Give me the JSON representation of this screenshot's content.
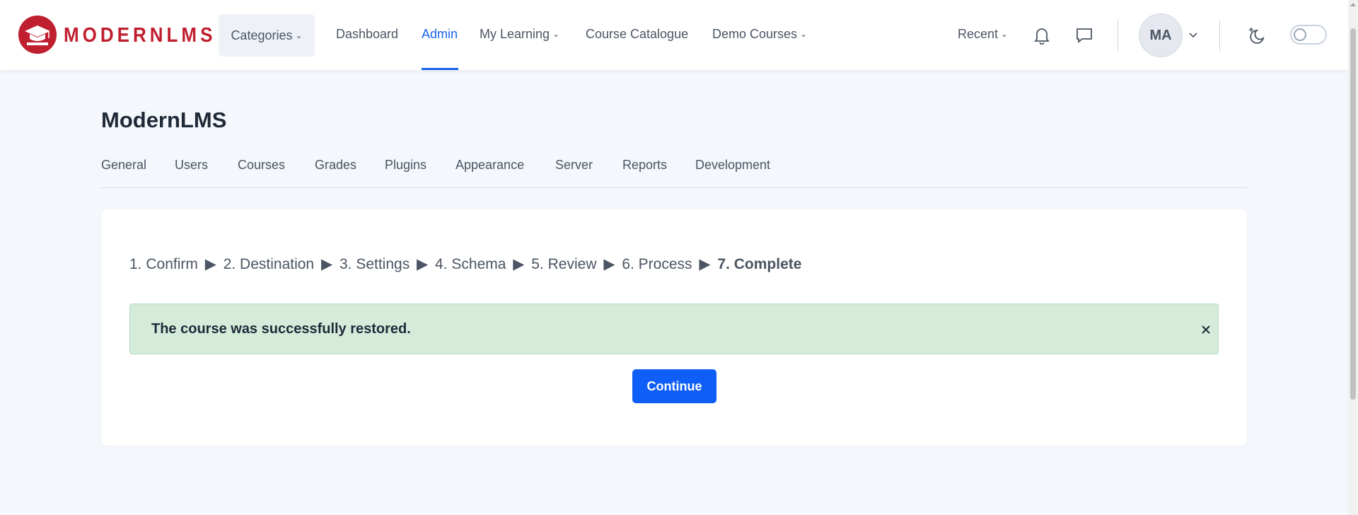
{
  "brand": {
    "name": "MODERNLMS",
    "color": "#c01f2f"
  },
  "nav": {
    "categories_label": "Categories",
    "links": [
      {
        "label": "Dashboard"
      },
      {
        "label": "Admin",
        "active": true
      },
      {
        "label": "My Learning"
      },
      {
        "label": "Course Catalogue"
      },
      {
        "label": "Demo Courses"
      }
    ],
    "recent_label": "Recent",
    "user_initials": "MA",
    "accent_color": "#1664e8"
  },
  "page": {
    "title": "ModernLMS",
    "tabs": [
      {
        "label": "General"
      },
      {
        "label": "Users"
      },
      {
        "label": "Courses"
      },
      {
        "label": "Grades"
      },
      {
        "label": "Plugins"
      },
      {
        "label": "Appearance"
      },
      {
        "label": "Server"
      },
      {
        "label": "Reports"
      },
      {
        "label": "Development"
      }
    ]
  },
  "restore": {
    "steps": [
      "1. Confirm",
      "2. Destination",
      "3. Settings",
      "4. Schema",
      "5. Review",
      "6. Process",
      "7. Complete"
    ],
    "step_separator": "▶",
    "current_step": "7. Complete",
    "alert_message": "The course was successfully restored.",
    "alert_color": "#d5ecdb",
    "continue_label": "Continue",
    "button_color": "#0f5ef7"
  }
}
